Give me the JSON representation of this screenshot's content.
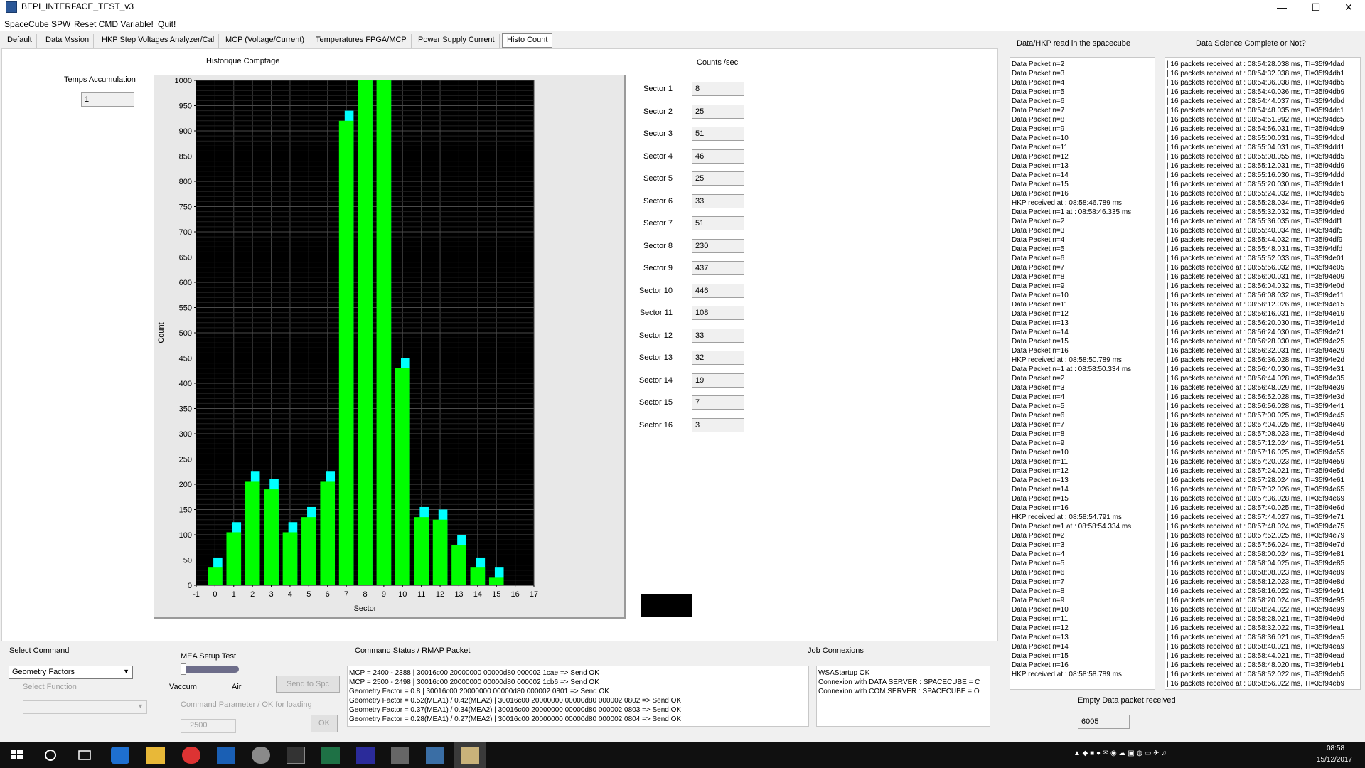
{
  "window": {
    "title": "BEPI_INTERFACE_TEST_v3",
    "minimize": "—",
    "maximize": "☐",
    "close": "✕"
  },
  "menu": [
    "SpaceCube SPW",
    "Reset CMD Variable!",
    "Quit!"
  ],
  "tabs": [
    "Default",
    "Data Mssion",
    "HKP Step Voltages Analyzer/Cal",
    "MCP (Voltage/Current)",
    "Temperatures FPGA/MCP",
    "Power Supply Current",
    "Histo Count"
  ],
  "active_tab": "Histo Count",
  "histo": {
    "temps_label": "Temps Accumulation",
    "temps_value": "1",
    "chart_title": "Historique Comptage",
    "counts_header": "Counts /sec",
    "sectors": [
      {
        "label": "Sector 1",
        "value": "8"
      },
      {
        "label": "Sector 2",
        "value": "25"
      },
      {
        "label": "Sector 3",
        "value": "51"
      },
      {
        "label": "Sector 4",
        "value": "46"
      },
      {
        "label": "Sector 5",
        "value": "25"
      },
      {
        "label": "Sector 6",
        "value": "33"
      },
      {
        "label": "Sector 7",
        "value": "51"
      },
      {
        "label": "Sector 8",
        "value": "230"
      },
      {
        "label": "Sector 9",
        "value": "437"
      },
      {
        "label": "Sector 10",
        "value": "446"
      },
      {
        "label": "Sector 11",
        "value": "108"
      },
      {
        "label": "Sector 12",
        "value": "33"
      },
      {
        "label": "Sector 13",
        "value": "32"
      },
      {
        "label": "Sector 14",
        "value": "19"
      },
      {
        "label": "Sector 15",
        "value": "7"
      },
      {
        "label": "Sector 16",
        "value": "3"
      }
    ]
  },
  "chart_data": {
    "type": "bar",
    "title": "Historique Comptage",
    "xlabel": "Sector",
    "ylabel": "Count",
    "xlim": [
      -1,
      17
    ],
    "ylim": [
      0,
      1000
    ],
    "xticks": [
      -1,
      0,
      1,
      2,
      3,
      4,
      5,
      6,
      7,
      8,
      9,
      10,
      11,
      12,
      13,
      14,
      15,
      16,
      17
    ],
    "yticks": [
      0,
      50,
      100,
      150,
      200,
      250,
      300,
      350,
      400,
      450,
      500,
      550,
      600,
      650,
      700,
      750,
      800,
      850,
      900,
      950,
      1000
    ],
    "background": "#000000",
    "grid": true,
    "series": [
      {
        "color": "#00ff00",
        "x": [
          0,
          1,
          2,
          3,
          4,
          5,
          6,
          7,
          8,
          9,
          10,
          11,
          12,
          13,
          14,
          15
        ],
        "values": [
          35,
          105,
          205,
          190,
          105,
          135,
          205,
          920,
          1000,
          1000,
          430,
          135,
          130,
          80,
          35,
          15
        ]
      },
      {
        "color": "#00ffff",
        "x": [
          0,
          1,
          2,
          3,
          4,
          5,
          6,
          7,
          8,
          9,
          10,
          11,
          12,
          13,
          14,
          15
        ],
        "values": [
          55,
          125,
          225,
          210,
          125,
          155,
          225,
          940,
          1000,
          1000,
          450,
          155,
          150,
          100,
          55,
          35
        ]
      }
    ]
  },
  "right_panel": {
    "hkp_header": "Data/HKP read in the spacecube",
    "science_header": "Data Science Complete or Not?",
    "empty_label": "Empty Data packet received",
    "empty_value": "6005",
    "hkp_log": [
      "Data Packet n=2",
      "Data Packet n=3",
      "Data Packet n=4",
      "Data Packet n=5",
      "Data Packet n=6",
      "Data Packet n=7",
      "Data Packet n=8",
      "Data Packet n=9",
      "Data Packet n=10",
      "Data Packet n=11",
      "Data Packet n=12",
      "Data Packet n=13",
      "Data Packet n=14",
      "Data Packet n=15",
      "Data Packet n=16",
      "HKP received at : 08:58:46.789 ms",
      "Data Packet n=1 at : 08:58:46.335 ms",
      "Data Packet n=2",
      "Data Packet n=3",
      "Data Packet n=4",
      "Data Packet n=5",
      "Data Packet n=6",
      "Data Packet n=7",
      "Data Packet n=8",
      "Data Packet n=9",
      "Data Packet n=10",
      "Data Packet n=11",
      "Data Packet n=12",
      "Data Packet n=13",
      "Data Packet n=14",
      "Data Packet n=15",
      "Data Packet n=16",
      "HKP received at : 08:58:50.789 ms",
      "Data Packet n=1 at : 08:58:50.334 ms",
      "Data Packet n=2",
      "Data Packet n=3",
      "Data Packet n=4",
      "Data Packet n=5",
      "Data Packet n=6",
      "Data Packet n=7",
      "Data Packet n=8",
      "Data Packet n=9",
      "Data Packet n=10",
      "Data Packet n=11",
      "Data Packet n=12",
      "Data Packet n=13",
      "Data Packet n=14",
      "Data Packet n=15",
      "Data Packet n=16",
      "HKP received at : 08:58:54.791 ms",
      "Data Packet n=1 at : 08:58:54.334 ms",
      "Data Packet n=2",
      "Data Packet n=3",
      "Data Packet n=4",
      "Data Packet n=5",
      "Data Packet n=6",
      "Data Packet n=7",
      "Data Packet n=8",
      "Data Packet n=9",
      "Data Packet n=10",
      "Data Packet n=11",
      "Data Packet n=12",
      "Data Packet n=13",
      "Data Packet n=14",
      "Data Packet n=15",
      "Data Packet n=16",
      "HKP received at : 08:58:58.789 ms"
    ],
    "science_log": [
      "| 16 packets received at : 08:54:28.038 ms, TI=35f94dad",
      "| 16 packets received at : 08:54:32.038 ms, TI=35f94db1",
      "| 16 packets received at : 08:54:36.038 ms, TI=35f94db5",
      "| 16 packets received at : 08:54:40.036 ms, TI=35f94db9",
      "| 16 packets received at : 08:54:44.037 ms, TI=35f94dbd",
      "| 16 packets received at : 08:54:48.035 ms, TI=35f94dc1",
      "| 16 packets received at : 08:54:51.992 ms, TI=35f94dc5",
      "| 16 packets received at : 08:54:56.031 ms, TI=35f94dc9",
      "| 16 packets received at : 08:55:00.031 ms, TI=35f94dcd",
      "| 16 packets received at : 08:55:04.031 ms, TI=35f94dd1",
      "| 16 packets received at : 08:55:08.055 ms, TI=35f94dd5",
      "| 16 packets received at : 08:55:12.031 ms, TI=35f94dd9",
      "| 16 packets received at : 08:55:16.030 ms, TI=35f94ddd",
      "| 16 packets received at : 08:55:20.030 ms, TI=35f94de1",
      "| 16 packets received at : 08:55:24.032 ms, TI=35f94de5",
      "| 16 packets received at : 08:55:28.034 ms, TI=35f94de9",
      "| 16 packets received at : 08:55:32.032 ms, TI=35f94ded",
      "| 16 packets received at : 08:55:36.035 ms, TI=35f94df1",
      "| 16 packets received at : 08:55:40.034 ms, TI=35f94df5",
      "| 16 packets received at : 08:55:44.032 ms, TI=35f94df9",
      "| 16 packets received at : 08:55:48.031 ms, TI=35f94dfd",
      "| 16 packets received at : 08:55:52.033 ms, TI=35f94e01",
      "| 16 packets received at : 08:55:56.032 ms, TI=35f94e05",
      "| 16 packets received at : 08:56:00.031 ms, TI=35f94e09",
      "| 16 packets received at : 08:56:04.032 ms, TI=35f94e0d",
      "| 16 packets received at : 08:56:08.032 ms, TI=35f94e11",
      "| 16 packets received at : 08:56:12.026 ms, TI=35f94e15",
      "| 16 packets received at : 08:56:16.031 ms, TI=35f94e19",
      "| 16 packets received at : 08:56:20.030 ms, TI=35f94e1d",
      "| 16 packets received at : 08:56:24.030 ms, TI=35f94e21",
      "| 16 packets received at : 08:56:28.030 ms, TI=35f94e25",
      "| 16 packets received at : 08:56:32.031 ms, TI=35f94e29",
      "| 16 packets received at : 08:56:36.028 ms, TI=35f94e2d",
      "| 16 packets received at : 08:56:40.030 ms, TI=35f94e31",
      "| 16 packets received at : 08:56:44.028 ms, TI=35f94e35",
      "| 16 packets received at : 08:56:48.029 ms, TI=35f94e39",
      "| 16 packets received at : 08:56:52.028 ms, TI=35f94e3d",
      "| 16 packets received at : 08:56:56.028 ms, TI=35f94e41",
      "| 16 packets received at : 08:57:00.025 ms, TI=35f94e45",
      "| 16 packets received at : 08:57:04.025 ms, TI=35f94e49",
      "| 16 packets received at : 08:57:08.023 ms, TI=35f94e4d",
      "| 16 packets received at : 08:57:12.024 ms, TI=35f94e51",
      "| 16 packets received at : 08:57:16.025 ms, TI=35f94e55",
      "| 16 packets received at : 08:57:20.023 ms, TI=35f94e59",
      "| 16 packets received at : 08:57:24.021 ms, TI=35f94e5d",
      "| 16 packets received at : 08:57:28.024 ms, TI=35f94e61",
      "| 16 packets received at : 08:57:32.026 ms, TI=35f94e65",
      "| 16 packets received at : 08:57:36.028 ms, TI=35f94e69",
      "| 16 packets received at : 08:57:40.025 ms, TI=35f94e6d",
      "| 16 packets received at : 08:57:44.027 ms, TI=35f94e71",
      "| 16 packets received at : 08:57:48.024 ms, TI=35f94e75",
      "| 16 packets received at : 08:57:52.025 ms, TI=35f94e79",
      "| 16 packets received at : 08:57:56.024 ms, TI=35f94e7d",
      "| 16 packets received at : 08:58:00.024 ms, TI=35f94e81",
      "| 16 packets received at : 08:58:04.025 ms, TI=35f94e85",
      "| 16 packets received at : 08:58:08.023 ms, TI=35f94e89",
      "| 16 packets received at : 08:58:12.023 ms, TI=35f94e8d",
      "| 16 packets received at : 08:58:16.022 ms, TI=35f94e91",
      "| 16 packets received at : 08:58:20.024 ms, TI=35f94e95",
      "| 16 packets received at : 08:58:24.022 ms, TI=35f94e99",
      "| 16 packets received at : 08:58:28.021 ms, TI=35f94e9d",
      "| 16 packets received at : 08:58:32.022 ms, TI=35f94ea1",
      "| 16 packets received at : 08:58:36.021 ms, TI=35f94ea5",
      "| 16 packets received at : 08:58:40.021 ms, TI=35f94ea9",
      "| 16 packets received at : 08:58:44.021 ms, TI=35f94ead",
      "| 16 packets received at : 08:58:48.020 ms, TI=35f94eb1",
      "| 16 packets received at : 08:58:52.022 ms, TI=35f94eb5",
      "| 16 packets received at : 08:58:56.022 ms, TI=35f94eb9"
    ]
  },
  "bottom": {
    "select_command_label": "Select Command",
    "command_value": "Geometry Factors",
    "select_function_label": "Select Function",
    "function_value": "",
    "mea_label": "MEA Setup Test",
    "vaccum_label": "Vaccum",
    "air_label": "Air",
    "mea_level": 0,
    "send_button": "Send to Spc",
    "param_label": "Command Parameter / OK for loading",
    "param_value": "2500",
    "ok_button": "OK",
    "status_label": "Command Status / RMAP Packet",
    "status_lines": [
      "MCP = 2400 - 2388    | 30016c00 20000000 00000d80 000002 1cae    => Send OK",
      "MCP = 2500 - 2498    | 30016c00 20000000 00000d80 000002 1cb6    => Send OK",
      "Geometry Factor = 0.8     | 30016c00 20000000 00000d80 000002 0801    => Send OK",
      "Geometry Factor = 0.52(MEA1) / 0.42(MEA2)       | 30016c00 20000000 00000d80 000002 0802    => Send OK",
      "Geometry Factor = 0.37(MEA1) / 0.34(MEA2)       | 30016c00 20000000 00000d80 000002 0803    => Send OK",
      "Geometry Factor = 0.28(MEA1) / 0.27(MEA2)       | 30016c00 20000000 00000d80 000002 0804    => Send OK"
    ],
    "job_label": "Job Connexions",
    "job_lines": [
      "WSAStartup OK",
      "Connexion with DATA SERVER : SPACECUBE = C",
      "Connexion with COM SERVER : SPACECUBE = O"
    ]
  },
  "taskbar": {
    "icons": [
      "windows-start-icon",
      "search-circle-icon",
      "task-view-icon",
      "edge-icon",
      "file-explorer-icon",
      "chrome-icon",
      "outlook-icon",
      "app-icon",
      "terminal-icon",
      "excel-icon",
      "app-plus-icon",
      "calculator-icon",
      "network-app-icon",
      "active-app-icon"
    ],
    "time": "08:58",
    "date": "15/12/2017"
  }
}
